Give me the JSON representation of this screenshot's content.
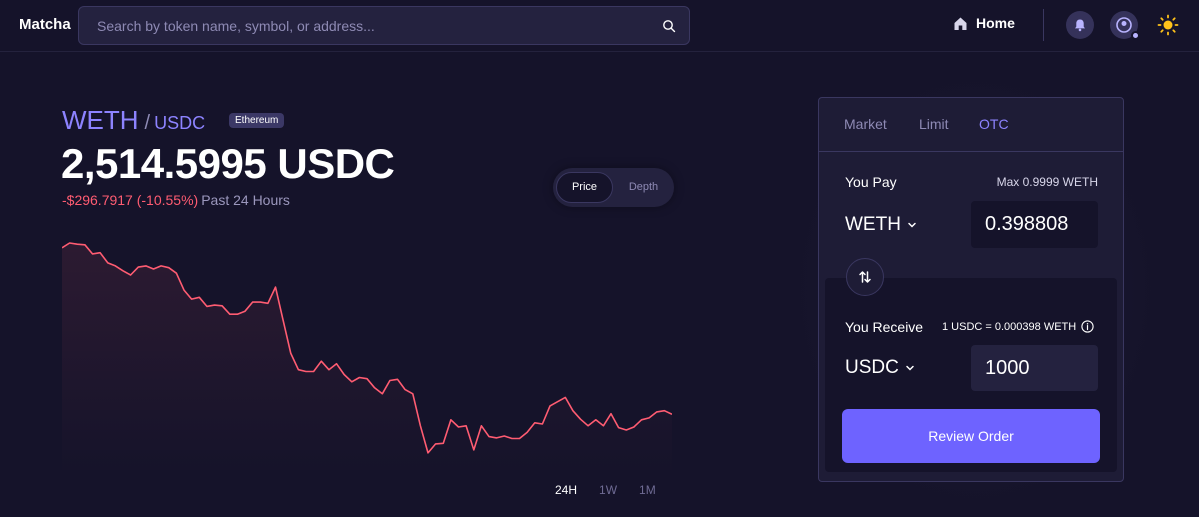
{
  "header": {
    "logo": "Matcha",
    "search_placeholder": "Search by token name, symbol, or address...",
    "home_label": "Home"
  },
  "pair": {
    "base": "WETH",
    "separator": "/",
    "quote": "USDC",
    "chain": "Ethereum",
    "price": "2,514.5995 USDC",
    "change": "-$296.7917 (-10.55%)",
    "period": "Past 24 Hours"
  },
  "chart_toggle": {
    "price": "Price",
    "depth": "Depth"
  },
  "timeframes": [
    "24H",
    "1W",
    "1M"
  ],
  "chart_data": {
    "type": "line",
    "series": [
      {
        "values": [
          2800,
          2808,
          2806,
          2805,
          2790,
          2792,
          2775,
          2770,
          2762,
          2755,
          2768,
          2770,
          2765,
          2770,
          2767,
          2758,
          2730,
          2715,
          2718,
          2703,
          2705,
          2704,
          2690,
          2690,
          2695,
          2710,
          2710,
          2708,
          2735,
          2680,
          2625,
          2598,
          2595,
          2595,
          2612,
          2598,
          2608,
          2590,
          2578,
          2585,
          2583,
          2568,
          2558,
          2580,
          2582,
          2565,
          2558,
          2505,
          2460,
          2475,
          2476,
          2515,
          2503,
          2505,
          2465,
          2505,
          2487,
          2485,
          2488,
          2484,
          2484,
          2494,
          2510,
          2508,
          2538,
          2545,
          2552,
          2530,
          2516,
          2505,
          2515,
          2505,
          2525,
          2502,
          2498,
          2503,
          2515,
          2518,
          2528,
          2530,
          2524
        ]
      }
    ],
    "color": "#ff5c72"
  },
  "trade": {
    "tabs": [
      "Market",
      "Limit",
      "OTC"
    ],
    "active_tab": "OTC",
    "pay_label": "You Pay",
    "max_label": "Max 0.9999 WETH",
    "pay_token": "WETH",
    "pay_amount": "0.398808",
    "receive_label": "You Receive",
    "rate": "1 USDC = 0.000398 WETH",
    "receive_token": "USDC",
    "receive_amount": "1000",
    "review_label": "Review Order"
  }
}
